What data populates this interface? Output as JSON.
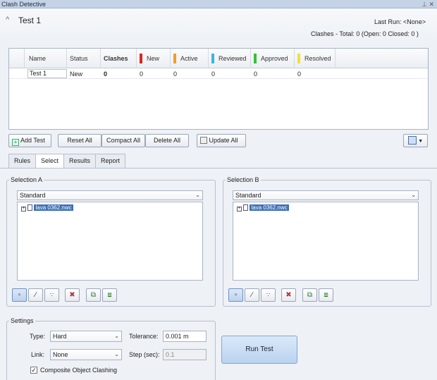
{
  "window": {
    "title": "Clash Detective",
    "pin_glyph": "⊥",
    "close_glyph": "✕"
  },
  "header": {
    "collapse_glyph": "^",
    "test_name": "Test 1",
    "last_run_label": "Last Run:",
    "last_run_value": "<None>",
    "summary": "Clashes - Total: 0 (Open: 0 Closed: 0 )"
  },
  "table": {
    "columns": [
      {
        "label": "Name",
        "color": ""
      },
      {
        "label": "Status",
        "color": ""
      },
      {
        "label": "Clashes",
        "color": "",
        "bold": true
      },
      {
        "label": "New",
        "color": "#d8261f"
      },
      {
        "label": "Active",
        "color": "#f29c25"
      },
      {
        "label": "Reviewed",
        "color": "#35b7e8"
      },
      {
        "label": "Approved",
        "color": "#36c136"
      },
      {
        "label": "Resolved",
        "color": "#f0e136"
      }
    ],
    "rows": [
      {
        "name": "Test 1",
        "status": "New",
        "clashes": "0",
        "new": "0",
        "active": "0",
        "reviewed": "0",
        "approved": "0",
        "resolved": "0"
      }
    ]
  },
  "toolbar": {
    "add_test": "Add Test",
    "reset_all": "Reset All",
    "compact_all": "Compact All",
    "delete_all": "Delete All",
    "update_all": "Update All"
  },
  "tabs": [
    {
      "label": "Rules",
      "active": false
    },
    {
      "label": "Select",
      "active": true
    },
    {
      "label": "Results",
      "active": false
    },
    {
      "label": "Report",
      "active": false
    }
  ],
  "selection_a": {
    "title": "Selection A",
    "combo": "Standard",
    "item": "lava 0362.nwc"
  },
  "selection_b": {
    "title": "Selection B",
    "combo": "Standard",
    "item": "lava 0362.nwc"
  },
  "settings": {
    "title": "Settings",
    "type_label": "Type:",
    "type_value": "Hard",
    "tolerance_label": "Tolerance:",
    "tolerance_value": "0.001 m",
    "link_label": "Link:",
    "link_value": "None",
    "step_label": "Step (sec):",
    "step_value": "0.1",
    "composite_label": "Composite Object Clashing",
    "composite_checked": true
  },
  "run_button": "Run Test"
}
